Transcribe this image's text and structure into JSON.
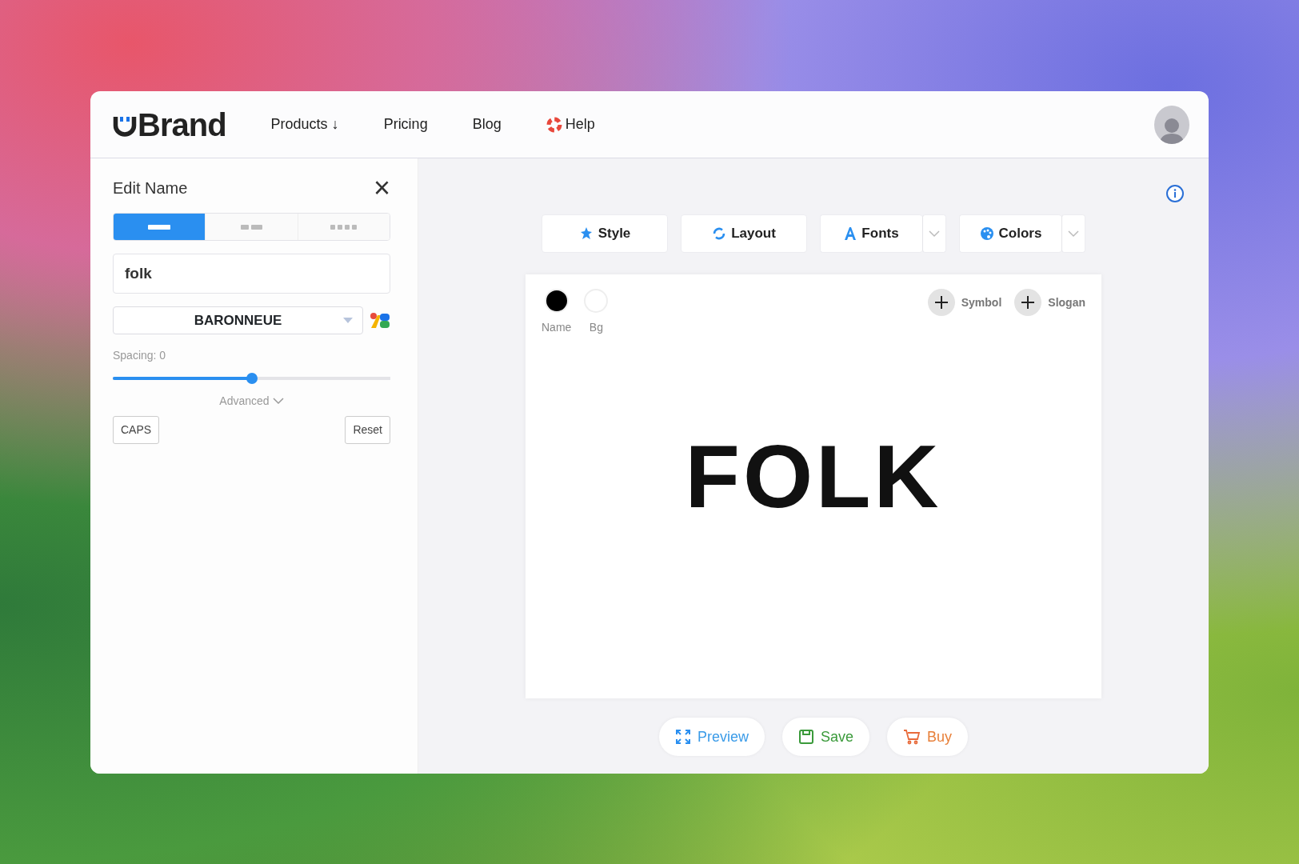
{
  "header": {
    "logo_text": "Brand",
    "nav": [
      {
        "label": "Products",
        "kind": "dropdown",
        "arrow": "↓"
      },
      {
        "label": "Pricing",
        "kind": "link"
      },
      {
        "label": "Blog",
        "kind": "link"
      },
      {
        "label": "Help",
        "kind": "help"
      }
    ]
  },
  "side_panel": {
    "title": "Edit Name",
    "close": "×",
    "layout_options": [
      {
        "kind": "one",
        "selected": true
      },
      {
        "kind": "two",
        "selected": false
      },
      {
        "kind": "four",
        "selected": false
      }
    ],
    "name_field": {
      "value": "folk"
    },
    "font_select": {
      "value": "BARONNEUE"
    },
    "spacing": {
      "label": "Spacing:",
      "reading": "0",
      "level": 0.5
    },
    "advanced": "Advanced",
    "buttons": [
      {
        "label": "CAPS"
      },
      {
        "label": "Reset"
      }
    ]
  },
  "toolbar": [
    {
      "label": "Style",
      "kind": "style",
      "has_dropdown": false
    },
    {
      "label": "Layout",
      "kind": "layout",
      "has_dropdown": false
    },
    {
      "label": "Fonts",
      "kind": "fonts",
      "has_dropdown": true
    },
    {
      "label": "Colors",
      "kind": "colors",
      "has_dropdown": true
    }
  ],
  "canvas": {
    "swatches": [
      {
        "label": "Name",
        "color": "#000000"
      },
      {
        "label": "Bg",
        "color": "#ffffff"
      }
    ],
    "add_buttons": [
      {
        "label": "Symbol"
      },
      {
        "label": "Slogan"
      }
    ],
    "logo_text": "FOLK"
  },
  "actions": [
    {
      "label": "Preview",
      "kind": "preview"
    },
    {
      "label": "Save",
      "kind": "save"
    },
    {
      "label": "Buy",
      "kind": "buy"
    }
  ]
}
